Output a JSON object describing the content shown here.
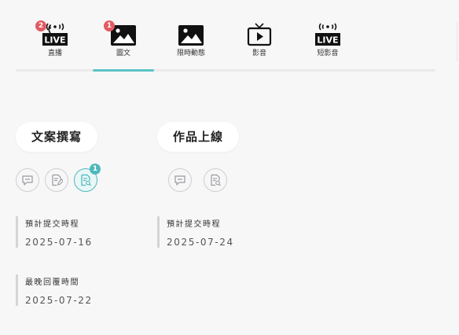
{
  "tabs": [
    {
      "label": "直播",
      "icon": "live-icon",
      "badge": "2"
    },
    {
      "label": "圖文",
      "icon": "image-icon",
      "badge": "1"
    },
    {
      "label": "限時動態",
      "icon": "image-icon",
      "badge": ""
    },
    {
      "label": "影音",
      "icon": "tv-play-icon",
      "badge": ""
    },
    {
      "label": "短影音",
      "icon": "live-icon",
      "badge": ""
    }
  ],
  "active_tab": 1,
  "colors": {
    "accent": "#5cc3c5",
    "badge_red": "#e25a62",
    "badge_teal": "#4fb8bc"
  },
  "col1": {
    "title": "文案撰寫",
    "active_badge": "1",
    "submit_label": "預計提交時程",
    "submit_date": "2025-07-16",
    "reply_label": "最晚回覆時間",
    "reply_date": "2025-07-22"
  },
  "col2": {
    "title": "作品上線",
    "submit_label": "預計提交時程",
    "submit_date": "2025-07-24"
  }
}
